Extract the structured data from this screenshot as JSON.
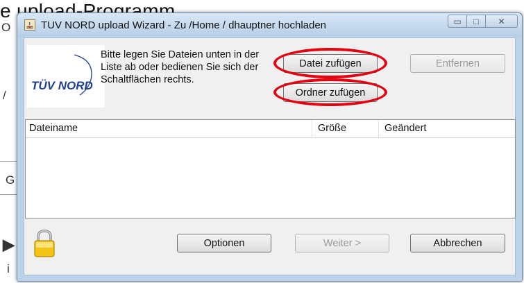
{
  "background": {
    "top_text": "e upload-Programm",
    "fragment_o": "O",
    "fragment_slash": "/",
    "fragment_g": "G",
    "fragment_i": "i"
  },
  "window": {
    "title": "TUV NORD upload Wizard - Zu /Home / dhauptner hochladen",
    "controls": {
      "minimize_glyph": "▭",
      "maximize_glyph": "□",
      "close_glyph": "✕"
    }
  },
  "logo": {
    "text": "TÜV NORD",
    "color": "#1f3f8f"
  },
  "instructions": "Bitte legen Sie Dateien unten in der Liste ab oder bedienen Sie sich der Schaltflächen rechts.",
  "buttons": {
    "add_file": "Datei zufügen",
    "remove": "Entfernen",
    "add_folder": "Ordner zufügen",
    "options": "Optionen",
    "next": "Weiter >",
    "cancel": "Abbrechen"
  },
  "file_list": {
    "columns": [
      "Dateiname",
      "Größe",
      "Geändert"
    ],
    "rows": []
  },
  "colors": {
    "highlight": "#e3000f",
    "window_frame": "#bcd3ea"
  }
}
